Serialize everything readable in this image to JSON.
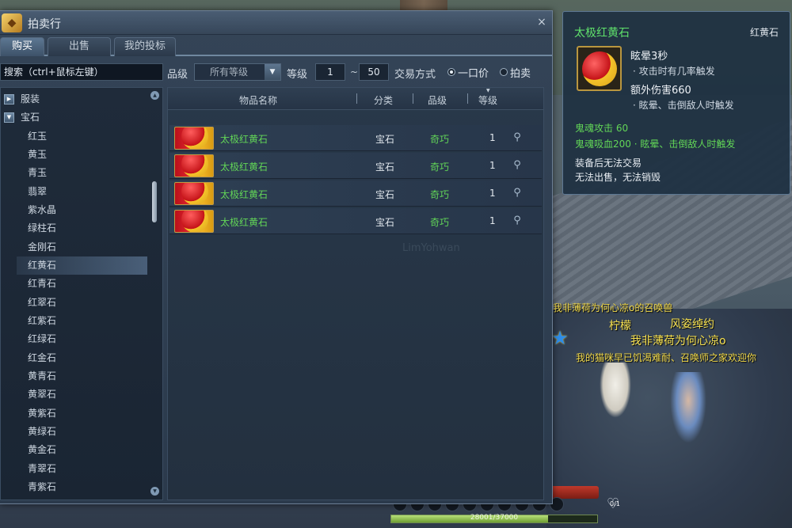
{
  "window": {
    "title": "拍卖行",
    "close_glyph": "×"
  },
  "tabs": [
    {
      "label": "购买",
      "active": true
    },
    {
      "label": "出售",
      "active": false
    },
    {
      "label": "我的投标",
      "active": false
    }
  ],
  "filters": {
    "search_placeholder": "搜索（ctrl+鼠标左键）",
    "grade_label": "品级",
    "grade_value": "所有等级",
    "level_label": "等级",
    "level_min": "1",
    "level_tilde": "~",
    "level_max": "50",
    "trade_label": "交易方式",
    "trade_options": [
      {
        "label": "一口价",
        "selected": true
      },
      {
        "label": "拍卖",
        "selected": false
      }
    ]
  },
  "category_tree": [
    {
      "label": "服装",
      "toggle": "▶"
    },
    {
      "label": "宝石",
      "toggle": "▼"
    },
    {
      "label": "红玉"
    },
    {
      "label": "黄玉"
    },
    {
      "label": "青玉"
    },
    {
      "label": "翡翠"
    },
    {
      "label": "紫水晶"
    },
    {
      "label": "绿柱石"
    },
    {
      "label": "金刚石"
    },
    {
      "label": "红黄石",
      "selected": true
    },
    {
      "label": "红青石"
    },
    {
      "label": "红翠石"
    },
    {
      "label": "红紫石"
    },
    {
      "label": "红绿石"
    },
    {
      "label": "红金石"
    },
    {
      "label": "黄青石"
    },
    {
      "label": "黄翠石"
    },
    {
      "label": "黄紫石"
    },
    {
      "label": "黄绿石"
    },
    {
      "label": "黄金石"
    },
    {
      "label": "青翠石"
    },
    {
      "label": "青紫石"
    }
  ],
  "list": {
    "columns": [
      "物品名称",
      "分类",
      "品级",
      "等级"
    ],
    "rows": [
      {
        "name": "太极红黄石",
        "category": "宝石",
        "grade": "奇巧",
        "level": "1"
      },
      {
        "name": "太极红黄石",
        "category": "宝石",
        "grade": "奇巧",
        "level": "1"
      },
      {
        "name": "太极红黄石",
        "category": "宝石",
        "grade": "奇巧",
        "level": "1"
      },
      {
        "name": "太极红黄石",
        "category": "宝石",
        "grade": "奇巧",
        "level": "1"
      }
    ]
  },
  "tooltip": {
    "name": "太极红黄石",
    "type": "红黄石",
    "stat1": "眩晕3秒",
    "stat1_note": "· 攻击时有几率触发",
    "stat2": "额外伤害660",
    "stat2_note": "· 眩晕、击倒敌人时触发",
    "bonus1": "鬼魂攻击 60",
    "bonus2": "鬼魂吸血200 · 眩晕、击倒敌人时触发",
    "bind1": "装备后无法交易",
    "bind2": "无法出售，无法销毁"
  },
  "world": {
    "pet_owner": "我非薄荷为何心凉o的召唤兽",
    "pet_name": "柠檬",
    "title_text": "风姿绰约",
    "player_name": "我非薄荷为何心凉o",
    "guild_text": "我的猫咪早已饥渴难耐、召唤师之家欢迎你"
  },
  "hud": {
    "heart_count": "0/1",
    "exp_text": "28001/37000",
    "exp_fraction": 0.76
  },
  "watermark": "LimYohwan",
  "colors": {
    "item_green": "#62d657",
    "world_yellow": "#f1d94a"
  },
  "icons": {
    "search": "magnifier-icon",
    "close": "close-icon"
  }
}
